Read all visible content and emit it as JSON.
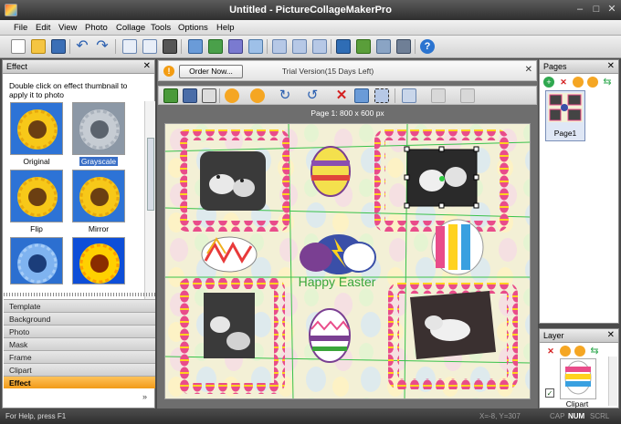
{
  "window": {
    "title": "Untitled - PictureCollageMakerPro"
  },
  "menu": [
    "File",
    "Edit",
    "View",
    "Photo",
    "Collage",
    "Tools",
    "Options",
    "Help"
  ],
  "effect_panel": {
    "title": "Effect",
    "hint": "Double click on effect thumbnail to apply it to photo",
    "thumbnails": [
      {
        "label": "Original",
        "selected": false
      },
      {
        "label": "Grayscale",
        "selected": true
      },
      {
        "label": "Flip",
        "selected": false
      },
      {
        "label": "Mirror",
        "selected": false
      },
      {
        "label": "",
        "selected": false
      },
      {
        "label": "",
        "selected": false
      }
    ]
  },
  "categories": [
    "Template",
    "Background",
    "Photo",
    "Mask",
    "Frame",
    "Clipart",
    "Effect"
  ],
  "trial": {
    "order_label": "Order Now...",
    "text": "Trial Version(15 Days Left)"
  },
  "page_info": "Page 1: 800 x 600 px",
  "canvas": {
    "caption": "Happy Easter"
  },
  "pages_panel": {
    "title": "Pages",
    "page_label": "Page1"
  },
  "layer_panel": {
    "title": "Layer",
    "item_label": "Clipart",
    "item_checked": true
  },
  "status": {
    "help": "For Help, press F1",
    "coords": "X=-8, Y=307",
    "cap": "CAP",
    "num": "NUM",
    "scrl": "SCRL"
  },
  "colors": {
    "accent": "#f5a623",
    "selection_green": "#2ecc40"
  }
}
